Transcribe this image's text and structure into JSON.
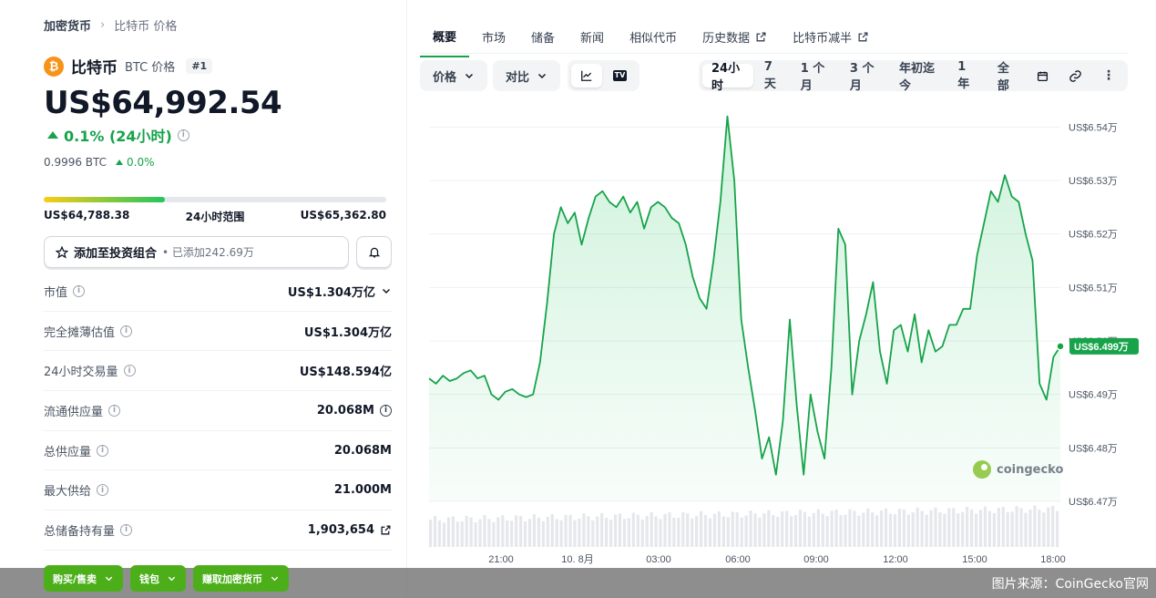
{
  "breadcrumb": {
    "root": "加密货币",
    "current": "比特币 价格"
  },
  "coin": {
    "logo_letter": "₿",
    "name": "比特币",
    "symbol_label": "BTC 价格",
    "rank": "#1",
    "price": "US$64,992.54",
    "change": "0.1% (24小时)",
    "btc_value": "0.9996 BTC",
    "btc_change": "0.0%"
  },
  "range": {
    "low": "US$64,788.38",
    "label": "24小时范围",
    "high": "US$65,362.80",
    "position_fraction": 0.355
  },
  "actions": {
    "watchlist_label": "添加至投资组合",
    "watchlist_count": "• 已添加242.69万"
  },
  "stats": [
    {
      "label": "市值",
      "value": "US$1.304万亿",
      "has_chevron": true
    },
    {
      "label": "完全摊薄估值",
      "value": "US$1.304万亿"
    },
    {
      "label": "24小时交易量",
      "value": "US$148.594亿"
    },
    {
      "label": "流通供应量",
      "value": "20.068M",
      "has_info": true
    },
    {
      "label": "总供应量",
      "value": "20.068M"
    },
    {
      "label": "最大供给",
      "value": "21.000M"
    },
    {
      "label": "总储备持有量",
      "value": "1,903,654",
      "has_link": true
    }
  ],
  "bottom_buttons": [
    "购买/售卖",
    "钱包",
    "赚取加密货币"
  ],
  "tabs": [
    {
      "label": "概要",
      "active": true
    },
    {
      "label": "市场"
    },
    {
      "label": "储备"
    },
    {
      "label": "新闻"
    },
    {
      "label": "相似代币"
    },
    {
      "label": "历史数据",
      "external": true
    },
    {
      "label": "比特币减半",
      "external": true
    }
  ],
  "toolbar": {
    "price_label": "价格",
    "compare_label": "对比",
    "ranges": [
      "24小时",
      "7天",
      "1 个月",
      "3 个月",
      "年初迄今",
      "1 年",
      "全部"
    ],
    "active_range": "24小时"
  },
  "watermark": "coingecko",
  "caption": "图片来源：CoinGecko官网",
  "colors": {
    "accent": "#16a34a",
    "brand": "#4caf1a",
    "btc": "#f7931a"
  },
  "chart_data": {
    "type": "line",
    "title": "",
    "xlabel": "",
    "ylabel": "",
    "x_ticks": [
      "21:00",
      "10. 8月",
      "03:00",
      "06:00",
      "09:00",
      "12:00",
      "15:00",
      "18:00"
    ],
    "y_ticks": [
      "US$6.54万",
      "US$6.53万",
      "US$6.52万",
      "US$6.51万",
      "US$6.50万",
      "US$6.49万",
      "US$6.48万",
      "US$6.47万"
    ],
    "ylim": [
      64700,
      65450
    ],
    "current_value_label": "US$6.499万",
    "series": [
      {
        "values": [
          64930,
          64920,
          64935,
          64925,
          64930,
          64940,
          64945,
          64930,
          64935,
          64900,
          64890,
          64905,
          64910,
          64900,
          64895,
          64900,
          64960,
          65070,
          65200,
          65250,
          65220,
          65240,
          65180,
          65230,
          65270,
          65280,
          65260,
          65250,
          65270,
          65240,
          65260,
          65210,
          65250,
          65260,
          65250,
          65230,
          65220,
          65180,
          65120,
          65080,
          65060,
          65150,
          65260,
          65420,
          65300,
          65040,
          64950,
          64870,
          64780,
          64820,
          64750,
          64850,
          65040,
          64880,
          64750,
          64900,
          64830,
          64780,
          64950,
          65210,
          65180,
          64900,
          65000,
          65050,
          65110,
          64980,
          64920,
          65020,
          65030,
          64980,
          65050,
          64960,
          65020,
          64980,
          64990,
          65030,
          65030,
          65060,
          65060,
          65160,
          65220,
          65280,
          65260,
          65310,
          65270,
          65260,
          65200,
          65150,
          64920,
          64890,
          64970,
          64990
        ]
      }
    ],
    "volume_bars": true
  }
}
